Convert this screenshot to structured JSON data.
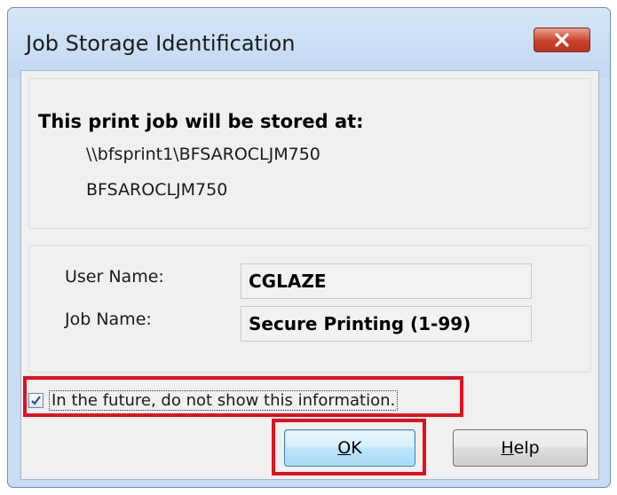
{
  "window": {
    "title": "Job Storage Identification",
    "close_icon": "close-icon"
  },
  "storage": {
    "heading": "This print job will be stored at:",
    "path": "\\\\bfsprint1\\BFSAROCLJM750",
    "printer": "BFSAROCLJM750"
  },
  "fields": {
    "user_name_label": "User Name:",
    "user_name_value": "CGLAZE",
    "job_name_label": "Job Name:",
    "job_name_value": "Secure Printing (1-99)"
  },
  "checkbox": {
    "label": "In the future, do not show this information.",
    "checked": true
  },
  "buttons": {
    "ok_mnemonic": "O",
    "ok_rest": "K",
    "help_mnemonic": "H",
    "help_rest": "elp"
  },
  "colors": {
    "highlight": "#e0101e",
    "close_button": "#c9432b"
  }
}
